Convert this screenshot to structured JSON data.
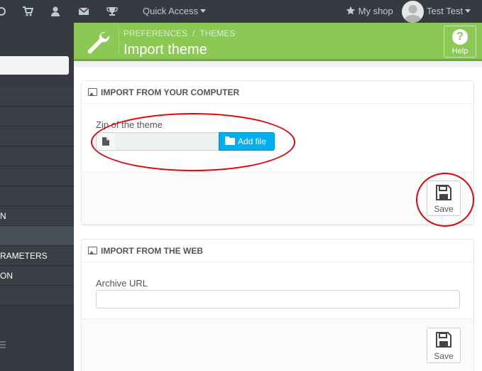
{
  "topbar": {
    "icons": [
      "user-fragment-icon",
      "cart-icon",
      "customer-icon",
      "envelope-icon",
      "trophy-icon"
    ],
    "quick_access": "Quick Access",
    "my_shop": "My shop",
    "user_name": "Test Test"
  },
  "sidebar": {
    "items": [
      "",
      "",
      "",
      "",
      "",
      "",
      "N",
      "",
      "RAMETERS",
      "ON",
      ""
    ]
  },
  "header": {
    "breadcrumb": [
      "PREFERENCES",
      "THEMES"
    ],
    "title": "Import theme",
    "help_label": "Help"
  },
  "panel_computer": {
    "title": "IMPORT FROM YOUR COMPUTER",
    "field_label": "Zip of the theme",
    "file_value": "",
    "add_file_label": "Add file",
    "save_label": "Save"
  },
  "panel_web": {
    "title": "IMPORT FROM THE WEB",
    "field_label": "Archive URL",
    "url_value": "",
    "save_label": "Save"
  },
  "colors": {
    "topbar": "#363a41",
    "header_green": "#8bc954",
    "add_file_blue": "#00aff0",
    "annotation_red": "#e0040b"
  }
}
